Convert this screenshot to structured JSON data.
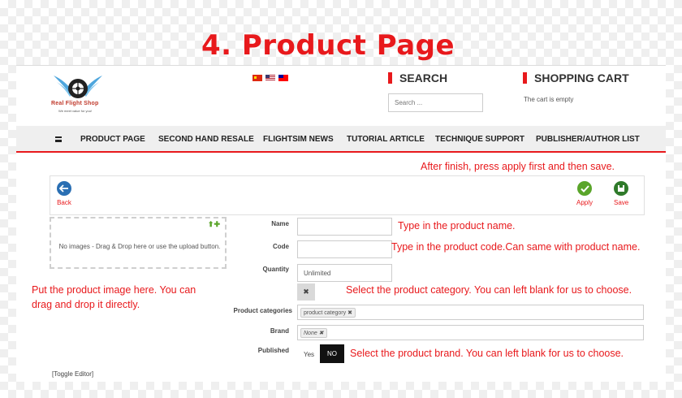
{
  "slide_title": "4. Product Page",
  "header": {
    "logo_name": "Real Flight Shop",
    "logo_tagline": "We meet value for you!",
    "search_title": "SEARCH",
    "search_placeholder": "Search ...",
    "cart_title": "SHOPPING CART",
    "cart_status": "The cart is empty",
    "flags": [
      "china-flag",
      "usa-flag",
      "taiwan-flag"
    ]
  },
  "nav": {
    "items": [
      "PRODUCT PAGE",
      "SECOND HAND RESALE",
      "FLIGHTSIM NEWS",
      "TUTORIAL ARTICLE",
      "TECHNIQUE SUPPORT",
      "PUBLISHER/AUTHOR LIST"
    ]
  },
  "toolbar": {
    "back_label": "Back",
    "apply_label": "Apply",
    "save_label": "Save"
  },
  "image_upload": {
    "text": "No images - Drag & Drop here or use the upload button."
  },
  "form": {
    "name_label": "Name",
    "name_value": "",
    "code_label": "Code",
    "code_value": "",
    "quantity_label": "Quantity",
    "quantity_value": "Unlimited",
    "category_label": "Product categories",
    "category_tag": "product category",
    "brand_label": "Brand",
    "brand_tag": "None",
    "published_label": "Published",
    "published_yes": "Yes",
    "published_no": "NO",
    "toggle_editor": "[Toggle Editor]"
  },
  "annotations": {
    "apply_note": "After finish, press apply first and then save.",
    "name_note": "Type in the product name.",
    "code_note": "Type in the product code.Can same with product name.",
    "image_note_1": "Put the product image here. You can",
    "image_note_2": "drag and drop it directly.",
    "category_note": "Select the product category. You can left blank for us to choose.",
    "brand_note": "Select the product brand. You can left blank for us to choose."
  },
  "colors": {
    "accent_red": "#e8191c",
    "nav_bg": "#efefef",
    "back_blue": "#2a6fb3",
    "apply_green": "#5aa52a"
  }
}
